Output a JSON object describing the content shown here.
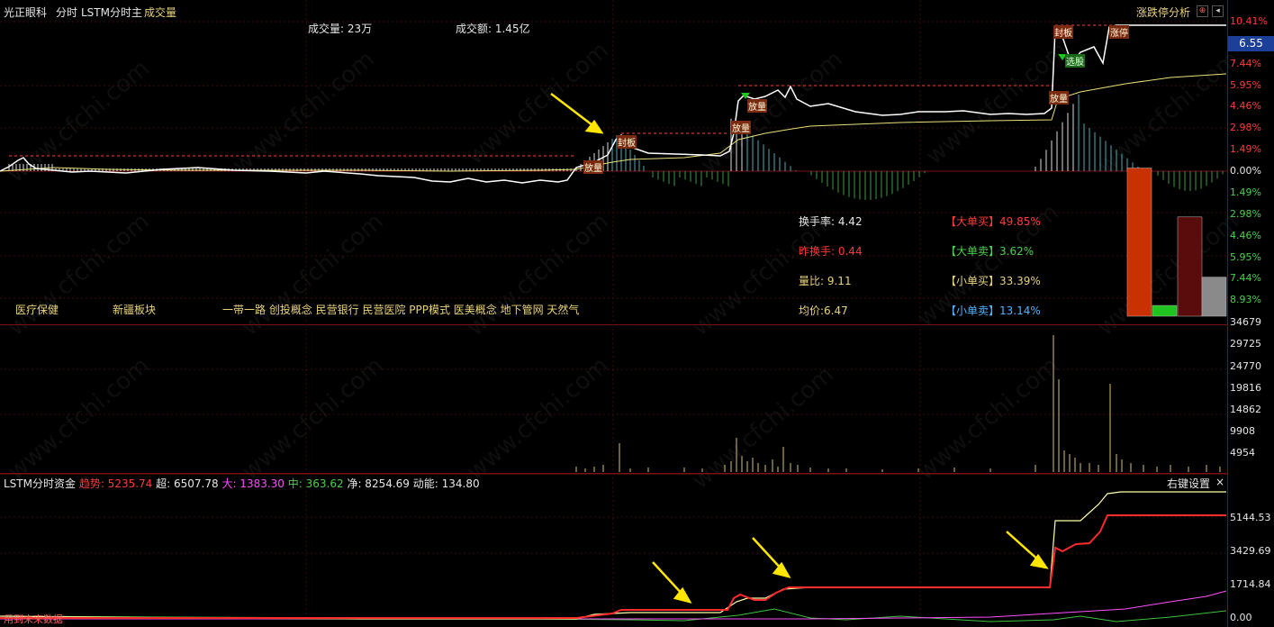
{
  "header": {
    "stock_name": "光正眼科",
    "mode": "分时",
    "indicator": "LSTM分时主",
    "volume_label": "成交量",
    "limit_analysis": "涨跌停分析",
    "volume_info": "成交量: 23万",
    "amount_info": "成交额: 1.45亿"
  },
  "price_axis": {
    "ticks": [
      "10.41%",
      "7.44%",
      "5.95%",
      "4.46%",
      "2.98%",
      "1.49%",
      "0.00%",
      "1.49%",
      "2.98%",
      "4.46%",
      "5.95%",
      "7.44%",
      "8.93%"
    ],
    "current_price": "6.55",
    "colors": {
      "up": "#ff3b3b",
      "flat": "#e6e6e6",
      "down": "#4bd04b",
      "current_bg": "#1c3f9a"
    }
  },
  "volume_axis": {
    "ticks": [
      "34679",
      "29725",
      "24770",
      "19816",
      "14862",
      "9908",
      "4954"
    ]
  },
  "fund_axis": {
    "ticks": [
      "5144.53",
      "3429.69",
      "1714.84",
      "0.00"
    ]
  },
  "stats": {
    "turnover": "换手率: 4.42",
    "prev_turnover": "昨换手: 0.44",
    "volume_ratio": "量比: 9.11",
    "avg_price": "均价:6.47",
    "big_buy": "【大单买】49.85%",
    "big_sell": "【大单卖】3.62%",
    "small_buy": "【小单买】33.39%",
    "small_sell": "【小单卖】13.14%"
  },
  "order_bars": {
    "big_buy": 49.85,
    "big_sell": 3.62,
    "small_buy": 33.39,
    "small_sell": 13.14,
    "colors": {
      "big_buy": "#c83200",
      "big_sell": "#1fc41f",
      "small_buy": "#5a0c0c",
      "small_sell": "#8a8a8a"
    }
  },
  "concepts": {
    "c1": "医疗保健",
    "c2": "新疆板块",
    "c3": "一带一路 创投概念 民营银行 民营医院 PPP模式 医美概念 地下管网 天然气"
  },
  "fund_panel": {
    "title": "LSTM分时资金",
    "trend": "趋势: 5235.74",
    "super": "超: 6507.78",
    "big": "大: 1383.30",
    "mid": "中: 363.62",
    "net": "净: 8254.69",
    "momentum": "动能: 134.80",
    "settings": "右键设置",
    "close": "×"
  },
  "chart_tags": {
    "fangliang": "放量",
    "fengban": "封板",
    "zhangting": "涨停",
    "xuangu": "选股"
  },
  "footer": {
    "future_data": "用到未来数据"
  },
  "watermark": "www.cfchi.com"
}
